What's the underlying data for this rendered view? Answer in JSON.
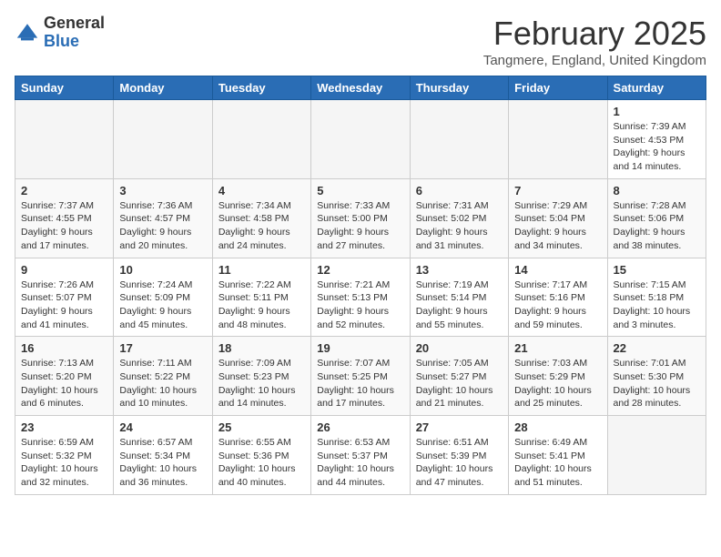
{
  "header": {
    "logo_general": "General",
    "logo_blue": "Blue",
    "month_title": "February 2025",
    "location": "Tangmere, England, United Kingdom"
  },
  "days_of_week": [
    "Sunday",
    "Monday",
    "Tuesday",
    "Wednesday",
    "Thursday",
    "Friday",
    "Saturday"
  ],
  "weeks": [
    [
      {
        "day": "",
        "info": ""
      },
      {
        "day": "",
        "info": ""
      },
      {
        "day": "",
        "info": ""
      },
      {
        "day": "",
        "info": ""
      },
      {
        "day": "",
        "info": ""
      },
      {
        "day": "",
        "info": ""
      },
      {
        "day": "1",
        "info": "Sunrise: 7:39 AM\nSunset: 4:53 PM\nDaylight: 9 hours and 14 minutes."
      }
    ],
    [
      {
        "day": "2",
        "info": "Sunrise: 7:37 AM\nSunset: 4:55 PM\nDaylight: 9 hours and 17 minutes."
      },
      {
        "day": "3",
        "info": "Sunrise: 7:36 AM\nSunset: 4:57 PM\nDaylight: 9 hours and 20 minutes."
      },
      {
        "day": "4",
        "info": "Sunrise: 7:34 AM\nSunset: 4:58 PM\nDaylight: 9 hours and 24 minutes."
      },
      {
        "day": "5",
        "info": "Sunrise: 7:33 AM\nSunset: 5:00 PM\nDaylight: 9 hours and 27 minutes."
      },
      {
        "day": "6",
        "info": "Sunrise: 7:31 AM\nSunset: 5:02 PM\nDaylight: 9 hours and 31 minutes."
      },
      {
        "day": "7",
        "info": "Sunrise: 7:29 AM\nSunset: 5:04 PM\nDaylight: 9 hours and 34 minutes."
      },
      {
        "day": "8",
        "info": "Sunrise: 7:28 AM\nSunset: 5:06 PM\nDaylight: 9 hours and 38 minutes."
      }
    ],
    [
      {
        "day": "9",
        "info": "Sunrise: 7:26 AM\nSunset: 5:07 PM\nDaylight: 9 hours and 41 minutes."
      },
      {
        "day": "10",
        "info": "Sunrise: 7:24 AM\nSunset: 5:09 PM\nDaylight: 9 hours and 45 minutes."
      },
      {
        "day": "11",
        "info": "Sunrise: 7:22 AM\nSunset: 5:11 PM\nDaylight: 9 hours and 48 minutes."
      },
      {
        "day": "12",
        "info": "Sunrise: 7:21 AM\nSunset: 5:13 PM\nDaylight: 9 hours and 52 minutes."
      },
      {
        "day": "13",
        "info": "Sunrise: 7:19 AM\nSunset: 5:14 PM\nDaylight: 9 hours and 55 minutes."
      },
      {
        "day": "14",
        "info": "Sunrise: 7:17 AM\nSunset: 5:16 PM\nDaylight: 9 hours and 59 minutes."
      },
      {
        "day": "15",
        "info": "Sunrise: 7:15 AM\nSunset: 5:18 PM\nDaylight: 10 hours and 3 minutes."
      }
    ],
    [
      {
        "day": "16",
        "info": "Sunrise: 7:13 AM\nSunset: 5:20 PM\nDaylight: 10 hours and 6 minutes."
      },
      {
        "day": "17",
        "info": "Sunrise: 7:11 AM\nSunset: 5:22 PM\nDaylight: 10 hours and 10 minutes."
      },
      {
        "day": "18",
        "info": "Sunrise: 7:09 AM\nSunset: 5:23 PM\nDaylight: 10 hours and 14 minutes."
      },
      {
        "day": "19",
        "info": "Sunrise: 7:07 AM\nSunset: 5:25 PM\nDaylight: 10 hours and 17 minutes."
      },
      {
        "day": "20",
        "info": "Sunrise: 7:05 AM\nSunset: 5:27 PM\nDaylight: 10 hours and 21 minutes."
      },
      {
        "day": "21",
        "info": "Sunrise: 7:03 AM\nSunset: 5:29 PM\nDaylight: 10 hours and 25 minutes."
      },
      {
        "day": "22",
        "info": "Sunrise: 7:01 AM\nSunset: 5:30 PM\nDaylight: 10 hours and 28 minutes."
      }
    ],
    [
      {
        "day": "23",
        "info": "Sunrise: 6:59 AM\nSunset: 5:32 PM\nDaylight: 10 hours and 32 minutes."
      },
      {
        "day": "24",
        "info": "Sunrise: 6:57 AM\nSunset: 5:34 PM\nDaylight: 10 hours and 36 minutes."
      },
      {
        "day": "25",
        "info": "Sunrise: 6:55 AM\nSunset: 5:36 PM\nDaylight: 10 hours and 40 minutes."
      },
      {
        "day": "26",
        "info": "Sunrise: 6:53 AM\nSunset: 5:37 PM\nDaylight: 10 hours and 44 minutes."
      },
      {
        "day": "27",
        "info": "Sunrise: 6:51 AM\nSunset: 5:39 PM\nDaylight: 10 hours and 47 minutes."
      },
      {
        "day": "28",
        "info": "Sunrise: 6:49 AM\nSunset: 5:41 PM\nDaylight: 10 hours and 51 minutes."
      },
      {
        "day": "",
        "info": ""
      }
    ]
  ]
}
